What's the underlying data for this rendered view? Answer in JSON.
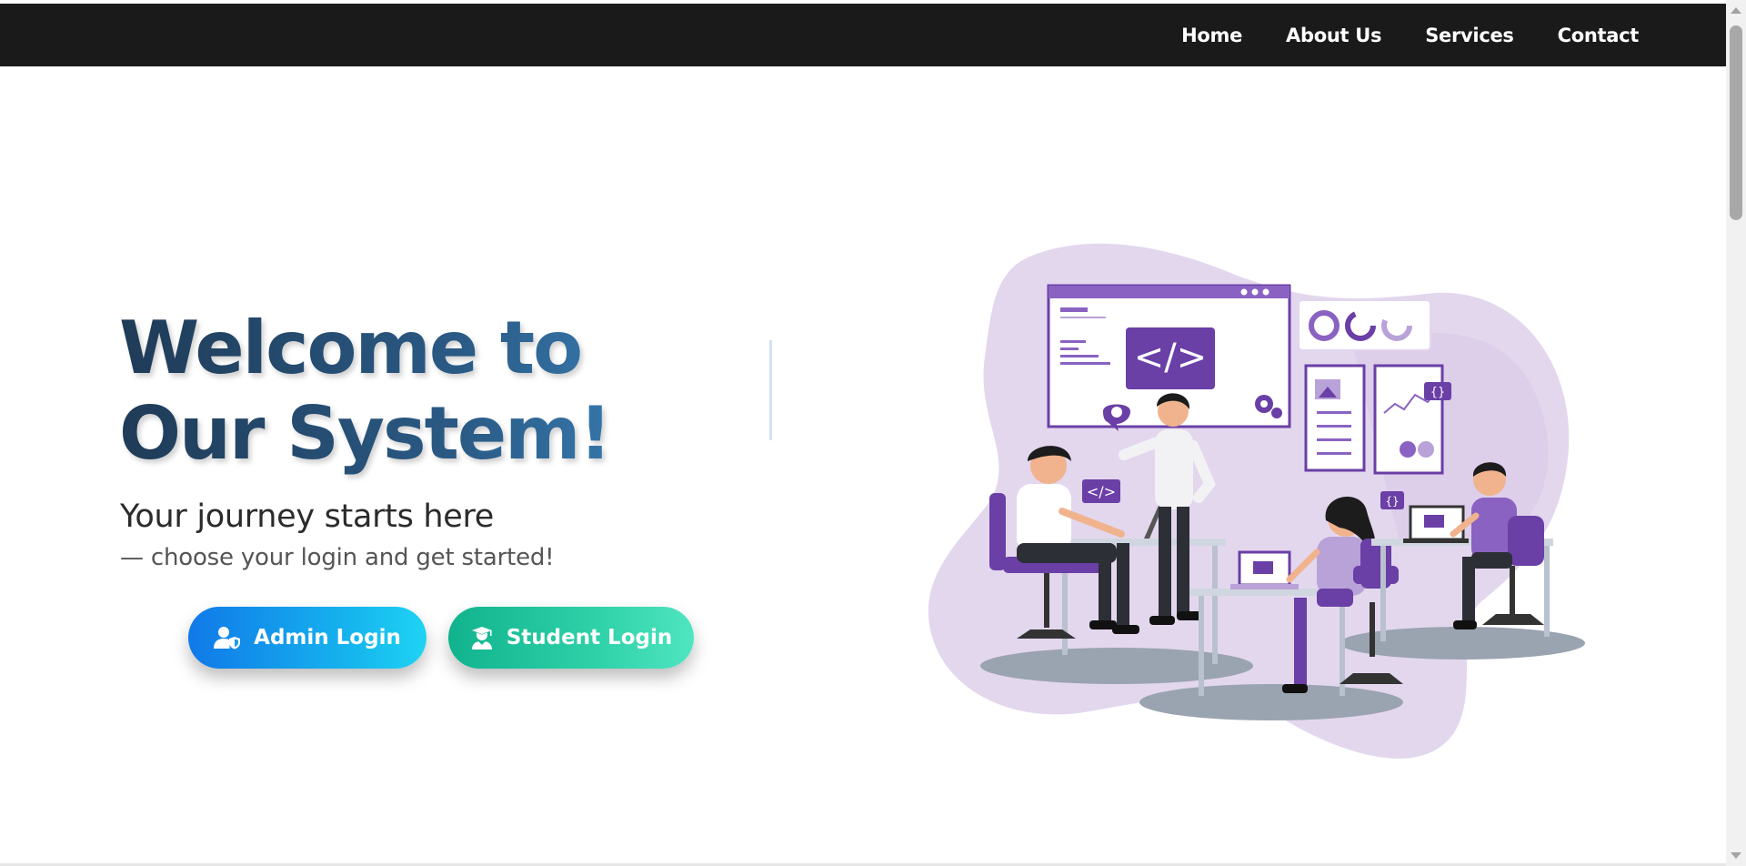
{
  "nav": {
    "items": [
      {
        "label": "Home"
      },
      {
        "label": "About Us"
      },
      {
        "label": "Services"
      },
      {
        "label": "Contact"
      }
    ]
  },
  "hero": {
    "title": "Welcome to Our System!",
    "subtitle": "Your journey starts here",
    "tagline": "— choose your login and get started!",
    "admin_button": {
      "label": "Admin Login",
      "icon": "user-shield-icon"
    },
    "student_button": {
      "label": "Student Login",
      "icon": "user-graduate-icon"
    }
  },
  "illustration": {
    "code_symbol": "</>",
    "brace_symbol": "{ }"
  },
  "colors": {
    "navbar": "#1a1a1a",
    "title_gradient_start": "#1f3b57",
    "title_gradient_end": "#3f8cc7",
    "admin_button": "#1079e8",
    "student_button": "#10b38d",
    "illustration_purple": "#6a3fa6",
    "illustration_blob": "#e3d7ee"
  }
}
